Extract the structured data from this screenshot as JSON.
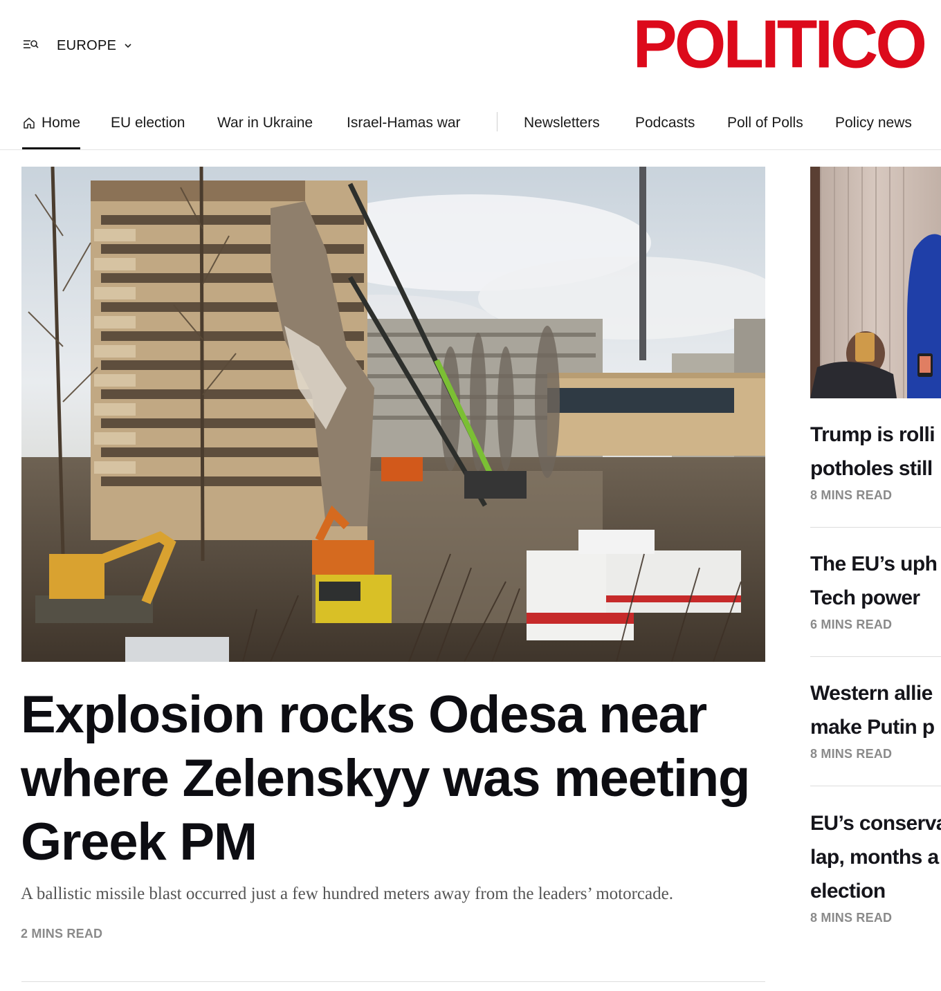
{
  "header": {
    "edition": "EUROPE",
    "logo": "POLITICO",
    "logo_color": "#dc0a1b",
    "menu_icon": "menu-search-icon",
    "edition_icon": "chevron-down-icon"
  },
  "nav": {
    "items": [
      {
        "label": "Home",
        "icon": "home-icon",
        "active": true
      },
      {
        "label": "EU election"
      },
      {
        "label": "War in Ukraine"
      },
      {
        "label": "Israel-Hamas war"
      },
      {
        "label": "Newsletters"
      },
      {
        "label": "Podcasts"
      },
      {
        "label": "Poll of Polls"
      },
      {
        "label": "Policy news"
      }
    ]
  },
  "lead": {
    "image_alt": "Damaged apartment block with cranes and emergency vehicles",
    "headline": "Explosion rocks Odesa near where Zelenskyy was meeting Greek PM",
    "dek": "A ballistic missile blast occurred just a few hundred meters away from the leaders’ motorcade.",
    "read_time": "2 MINS READ"
  },
  "rail": {
    "image_alt": "People photographing a speaker in a blue suit",
    "stories": [
      {
        "lines": [
          "Trump is rolli",
          "potholes still"
        ],
        "read_time": "8 MINS READ"
      },
      {
        "lines": [
          "The EU’s uph",
          "Tech power"
        ],
        "read_time": "6 MINS READ"
      },
      {
        "lines": [
          "Western allie",
          "make Putin p"
        ],
        "read_time": "8 MINS READ"
      },
      {
        "lines": [
          "EU’s conserva",
          "lap, months a",
          "election"
        ],
        "read_time": "8 MINS READ"
      }
    ]
  }
}
